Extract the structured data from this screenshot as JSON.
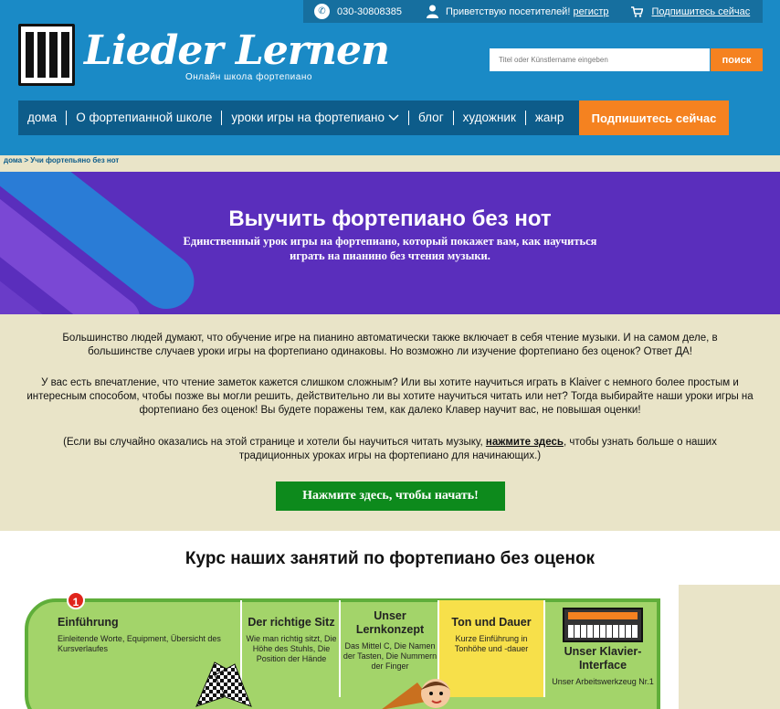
{
  "topbar": {
    "phone": "030-30808385",
    "greeting": "Приветствую посетителей!",
    "register": "регистр",
    "subscribe": "Подпишитесь сейчас"
  },
  "brand": {
    "title": "Lieder Lernen",
    "subtitle": "Онлайн школа фортепиано"
  },
  "search": {
    "placeholder": "Titel oder Künstlername eingeben",
    "button": "поиск"
  },
  "nav": {
    "items": [
      "дома",
      "О фортепианной школе",
      "уроки игры на фортепиано",
      "блог",
      "художник",
      "жанр"
    ],
    "cta": "Подпишитесь сейчас"
  },
  "breadcrumb": {
    "home": "дома",
    "separator": ">",
    "current": "Учи фортепьяно без нот"
  },
  "hero": {
    "title": "Выучить фортепиано без нот",
    "subtitle": "Единственный урок игры на фортепиано, который покажет вам, как научиться играть на пианино без чтения музыки."
  },
  "body": {
    "p1": "Большинство людей думают, что обучение игре на пианино автоматически также включает в себя чтение музыки. И на самом деле, в большинстве случаев уроки игры на фортепиано одинаковы. Но возможно ли изучение фортепиано без оценок? Ответ ДА!",
    "p2": "У вас есть впечатление, что чтение заметок кажется слишком сложным? Или вы хотите научиться играть в Klaiver с немного более простым и интересным способом, чтобы позже вы могли решить, действительно ли вы хотите научиться читать или нет? Тогда выбирайте наши уроки игры на фортепиано без оценок! Вы будете поражены тем, как далеко Клавер научит вас, не повышая оценки!",
    "p3_before": "(Если вы случайно оказались на этой странице и хотели бы научиться читать музыку, ",
    "p3_link": "нажмите здесь",
    "p3_after": ", чтобы узнать больше о наших традиционных уроках игры на фортепиано для начинающих.)",
    "start_button": "Нажмите здесь, чтобы начать!"
  },
  "course": {
    "title": "Курс наших занятий по фортепиано без оценок",
    "badge": "1",
    "panels": [
      {
        "title": "Einführung",
        "desc": "Einleitende Worte, Equipment, Übersicht des Kursverlaufes"
      },
      {
        "title": "Der richtige Sitz",
        "desc": "Wie man richtig sitzt, Die Höhe des Stuhls, Die Position der Hände"
      },
      {
        "title": "Unser Lernkonzept",
        "desc": "Das Mittel C, Die Namen der Tasten, Die Nummern der Finger"
      },
      {
        "title": "Ton und Dauer",
        "desc": "Kurze Einführung in Tonhöhe und -dauer"
      },
      {
        "title": "Unser Klavier-Interface",
        "desc": "Unser Arbeitswerkzeug Nr.1"
      }
    ]
  },
  "colors": {
    "header_blue": "#1a8ac6",
    "nav_blue": "#0d5c8a",
    "accent_orange": "#f58220",
    "hero_purple": "#5a2ebc",
    "cream": "#e9e4c8",
    "button_green": "#0d8a1c"
  }
}
